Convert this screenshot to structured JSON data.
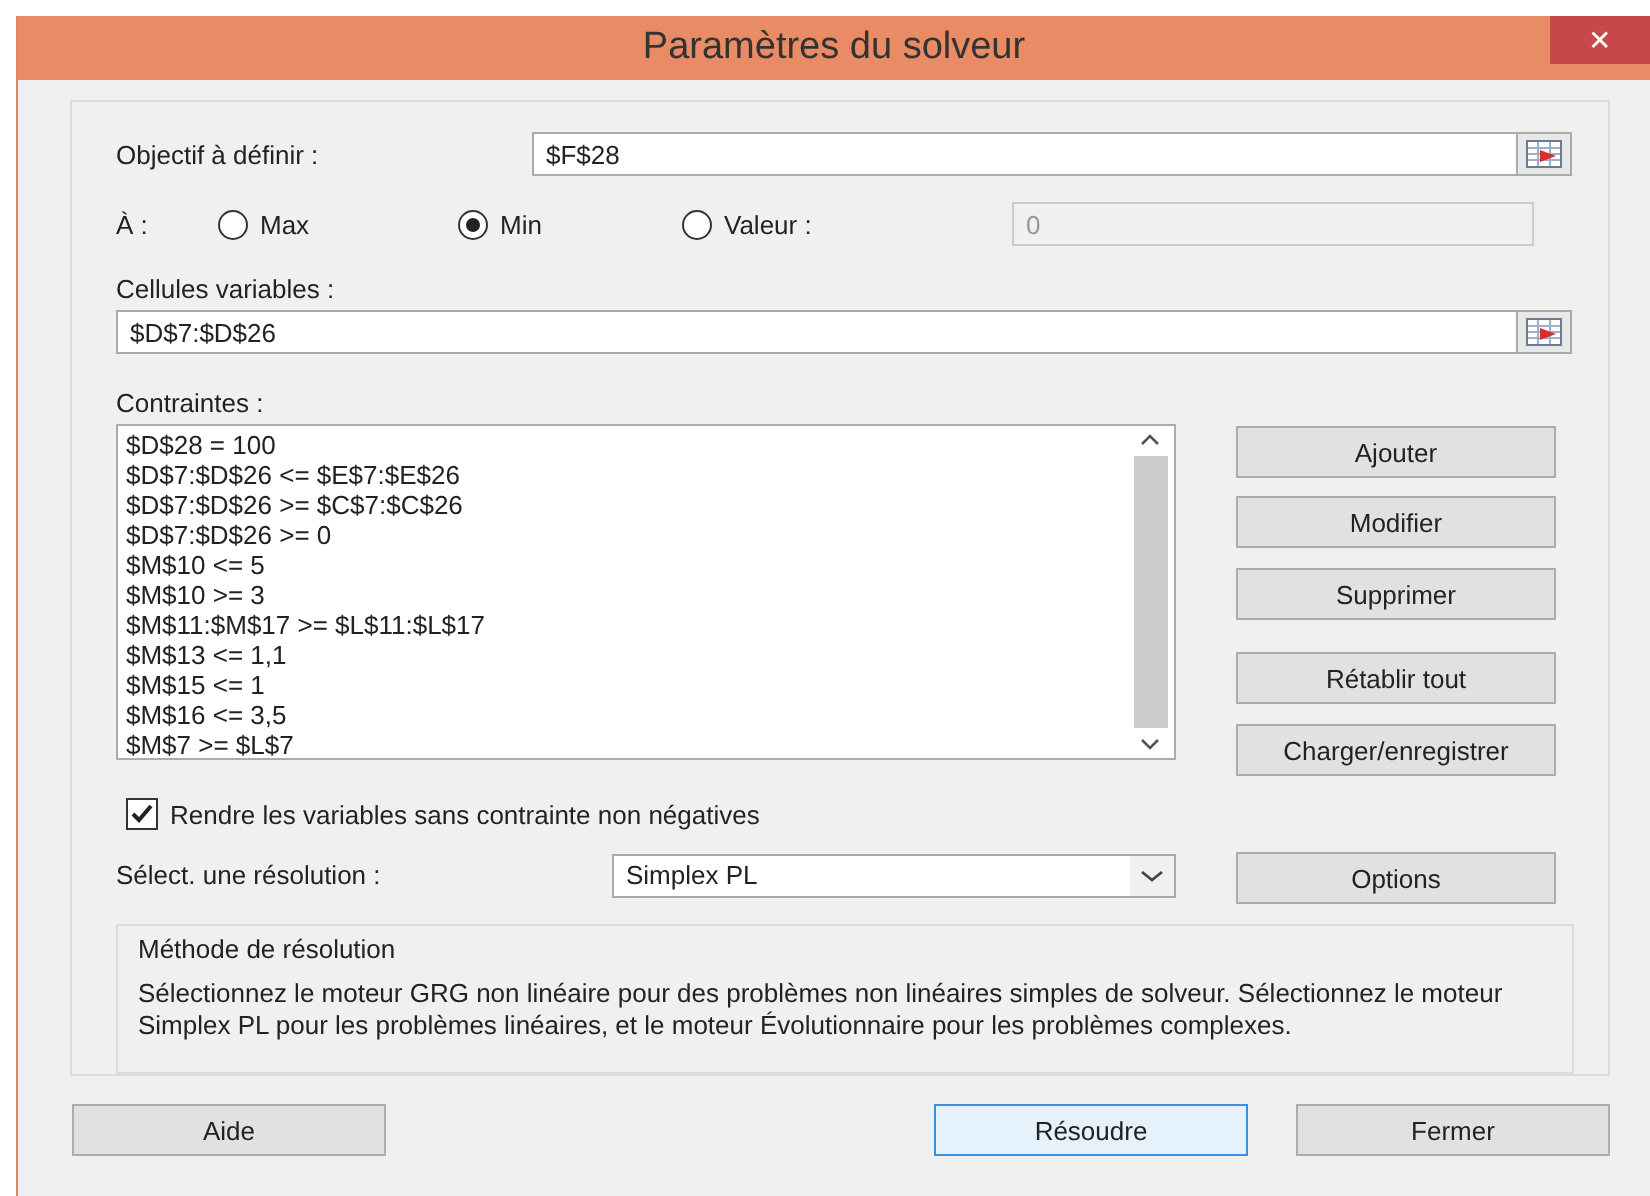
{
  "window": {
    "title": "Paramètres du solveur",
    "close": "✕"
  },
  "objective": {
    "label": "Objectif à définir :",
    "value": "$F$28"
  },
  "target": {
    "label": "À :",
    "options": [
      {
        "label": "Max",
        "selected": false
      },
      {
        "label": "Min",
        "selected": true
      },
      {
        "label": "Valeur :",
        "selected": false
      }
    ],
    "value_field": {
      "value": "0",
      "disabled": true
    }
  },
  "variable_cells": {
    "label": "Cellules variables :",
    "value": "$D$7:$D$26"
  },
  "constraints": {
    "label": "Contraintes :",
    "items": [
      "$D$28 = 100",
      "$D$7:$D$26 <= $E$7:$E$26",
      "$D$7:$D$26 >= $C$7:$C$26",
      "$D$7:$D$26 >= 0",
      "$M$10 <= 5",
      "$M$10 >= 3",
      "$M$11:$M$17 >= $L$11:$L$17",
      "$M$13 <= 1,1",
      "$M$15 <= 1",
      "$M$16 <= 3,5",
      "$M$7 >= $L$7"
    ]
  },
  "constraint_buttons": [
    "Ajouter",
    "Modifier",
    "Supprimer",
    "Rétablir tout",
    "Charger/enregistrer"
  ],
  "nonnegative": {
    "label": "Rendre les variables sans contrainte non négatives",
    "checked": true
  },
  "solving_method": {
    "label": "Sélect. une résolution :",
    "value": "Simplex PL"
  },
  "options_button": "Options",
  "method_description": {
    "title": "Méthode de résolution",
    "text": "Sélectionnez le moteur GRG non linéaire pour des problèmes non linéaires simples de solveur. Sélectionnez le moteur Simplex PL pour les problèmes linéaires, et le moteur Évolutionnaire pour les problèmes complexes."
  },
  "buttons": [
    {
      "label": "Aide",
      "focused": false
    },
    {
      "label": "Résoudre",
      "focused": true
    },
    {
      "label": "Fermer",
      "focused": false
    }
  ]
}
